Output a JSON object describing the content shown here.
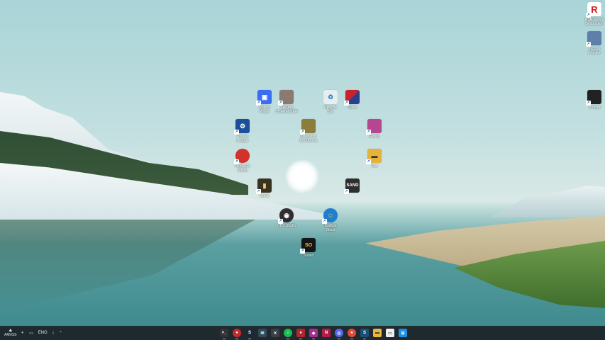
{
  "desktop_icons": [
    {
      "id": "roblox-player",
      "label_line1": "Roblox",
      "label_line2": "Player",
      "glyph": "▣",
      "color": "#3b6cf2"
    },
    {
      "id": "game-cover",
      "label_line1": "VRChat",
      "label_line2": "CHARACTER",
      "glyph": "",
      "color": "#8a7a72"
    },
    {
      "id": "recycle-bin",
      "label_line1": "Recycle",
      "label_line2": "Bin",
      "glyph": "♻",
      "color": "#e6eef2"
    },
    {
      "id": "game-red-blue",
      "label_line1": "Game",
      "label_line2": "",
      "glyph": "",
      "color": "#c8232c"
    },
    {
      "id": "rocket-league",
      "label_line1": "Rocket",
      "label_line2": "League",
      "glyph": "⚙",
      "color": "#1b4f9a"
    },
    {
      "id": "game-yellow",
      "label_line1": "Deeper in",
      "label_line2": "Backrooms",
      "glyph": "",
      "color": "#8c7d3a"
    },
    {
      "id": "game-pink",
      "label_line1": "Gorilla",
      "label_line2": "",
      "glyph": "",
      "color": "#b54790"
    },
    {
      "id": "roblox-studio",
      "label_line1": "ROBLOX",
      "label_line2": "Studio",
      "glyph": "",
      "color": "#d2322b"
    },
    {
      "id": "folder-game",
      "label_line1": "Fun",
      "label_line2": "",
      "glyph": "▬",
      "color": "#e5b23b"
    },
    {
      "id": "game-dark",
      "label_line1": "Game",
      "label_line2": "",
      "glyph": "▮",
      "color": "#3b3322"
    },
    {
      "id": "sand-game",
      "label_line1": "",
      "label_line2": "",
      "glyph": "SAND",
      "color": "#2e2e2e"
    },
    {
      "id": "obs-studio",
      "label_line1": "OBS Studio",
      "label_line2": "",
      "glyph": "◉",
      "color": "#302e31"
    },
    {
      "id": "badlion-client",
      "label_line1": "Badlion",
      "label_line2": "Client",
      "glyph": "☺",
      "color": "#1e7fd0"
    },
    {
      "id": "sound-app",
      "label_line1": "Sound",
      "label_line2": "",
      "glyph": "SO",
      "color": "#161616"
    },
    {
      "id": "rsr-global",
      "label_line1": "RSR Global",
      "label_line2": "Destruction",
      "glyph": "R",
      "color": "#c61f1f"
    },
    {
      "id": "top-right-2",
      "label_line1": "Tycoon",
      "label_line2": "Frontier",
      "glyph": "",
      "color": "#5d7fa9"
    },
    {
      "id": "right-game",
      "label_line1": "Tomato",
      "label_line2": "",
      "glyph": "",
      "color": "#222222"
    }
  ],
  "taskbar": {
    "weather_glyph": "⛰",
    "weather_text": "AM\\/GS",
    "lang": "ENG",
    "apps": [
      {
        "name": "terminal",
        "glyph": ">_",
        "color": "#333333"
      },
      {
        "name": "chrome-dev",
        "glyph": "●",
        "color": "#c72b2b"
      },
      {
        "name": "steam",
        "glyph": "S",
        "color": "#1b2838"
      },
      {
        "name": "mail",
        "glyph": "✉",
        "color": "#2d4b5a"
      },
      {
        "name": "app-x",
        "glyph": "✕",
        "color": "#3b3f44"
      },
      {
        "name": "spotify",
        "glyph": "♫",
        "color": "#1db954"
      },
      {
        "name": "app-red",
        "glyph": "●",
        "color": "#b3262e"
      },
      {
        "name": "app-multi",
        "glyph": "◆",
        "color": "#a32f8f"
      },
      {
        "name": "next",
        "glyph": "N",
        "color": "#b81a48"
      },
      {
        "name": "discord",
        "glyph": "◎",
        "color": "#5865f2"
      },
      {
        "name": "chrome",
        "glyph": "●",
        "color": "#e04a3c"
      },
      {
        "name": "steam-2",
        "glyph": "S",
        "color": "#1b4f7a"
      },
      {
        "name": "file-explorer",
        "glyph": "▬",
        "color": "#e9b73f"
      },
      {
        "name": "notepad",
        "glyph": "▭",
        "color": "#f1f1f1"
      },
      {
        "name": "start",
        "glyph": "⊞",
        "color": "#1d8fe6"
      }
    ]
  }
}
